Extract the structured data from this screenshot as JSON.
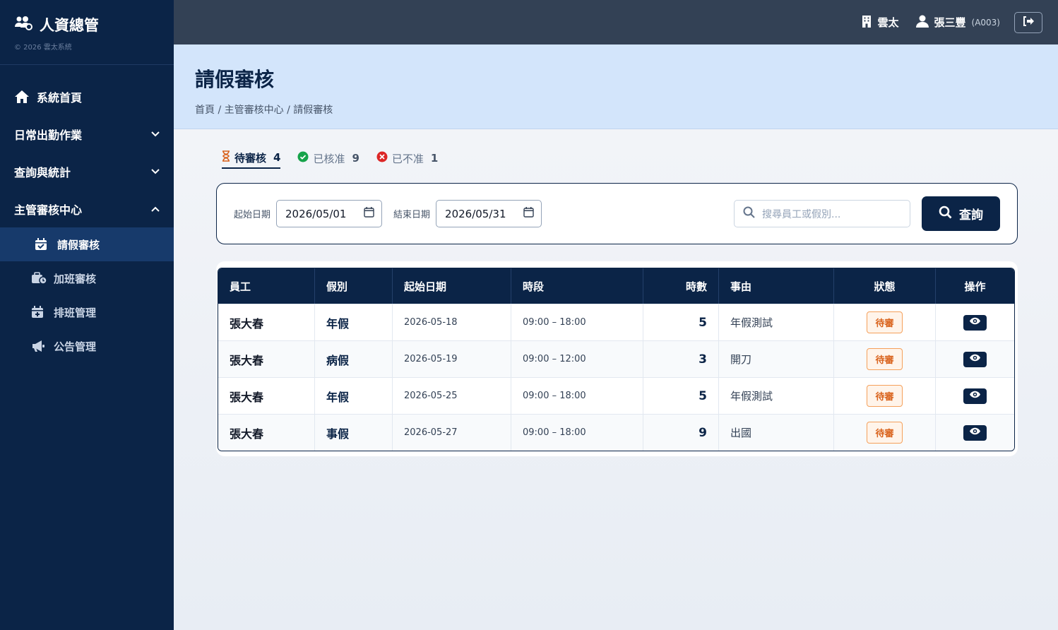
{
  "brand": {
    "title": "人資總管",
    "subtitle": "© 2026 雲太系統"
  },
  "sidebar": {
    "items": [
      {
        "label": "系統首頁",
        "icon": "home-icon"
      },
      {
        "label": "日常出勤作業",
        "icon": "chevron-down-icon"
      },
      {
        "label": "查詢與統計",
        "icon": "chevron-down-icon"
      },
      {
        "label": "主管審核中心",
        "icon": "chevron-up-icon"
      }
    ],
    "subitems": [
      {
        "label": "請假審核",
        "icon": "calendar-check-icon",
        "active": true
      },
      {
        "label": "加班審核",
        "icon": "briefcase-clock-icon"
      },
      {
        "label": "排班管理",
        "icon": "calendar-plus-icon"
      },
      {
        "label": "公告管理",
        "icon": "megaphone-icon"
      }
    ]
  },
  "topbar": {
    "company": "雲太",
    "user_name": "張三豐",
    "user_id": "(A003)"
  },
  "header": {
    "title": "請假審核",
    "breadcrumb": "首頁 / 主管審核中心 / 請假審核"
  },
  "tabs": [
    {
      "label": "待審核",
      "count": "4",
      "icon": "hourglass-icon",
      "active": true
    },
    {
      "label": "已核准",
      "count": "9",
      "icon": "check-circle-icon"
    },
    {
      "label": "已不准",
      "count": "1",
      "icon": "x-circle-icon"
    }
  ],
  "filter": {
    "start_label": "起始日期",
    "start_value": "2026/05/01",
    "end_label": "結束日期",
    "end_value": "2026/05/31",
    "search_placeholder": "搜尋員工或假別...",
    "query_label": "查詢"
  },
  "table": {
    "headers": [
      "員工",
      "假別",
      "起始日期",
      "時段",
      "時數",
      "事由",
      "狀態",
      "操作"
    ],
    "rows": [
      {
        "employee": "張大春",
        "type": "年假",
        "date": "2026-05-18",
        "period": "09:00 – 18:00",
        "hours": "5",
        "reason": "年假測試",
        "status": "待審"
      },
      {
        "employee": "張大春",
        "type": "病假",
        "date": "2026-05-19",
        "period": "09:00 – 12:00",
        "hours": "3",
        "reason": "開刀",
        "status": "待審"
      },
      {
        "employee": "張大春",
        "type": "年假",
        "date": "2026-05-25",
        "period": "09:00 – 18:00",
        "hours": "5",
        "reason": "年假測試",
        "status": "待審"
      },
      {
        "employee": "張大春",
        "type": "事假",
        "date": "2026-05-27",
        "period": "09:00 – 18:00",
        "hours": "9",
        "reason": "出國",
        "status": "待審"
      }
    ]
  },
  "colors": {
    "navy": "#0b2447",
    "header_band": "#d3e5fb",
    "pending": "#d9621b"
  }
}
